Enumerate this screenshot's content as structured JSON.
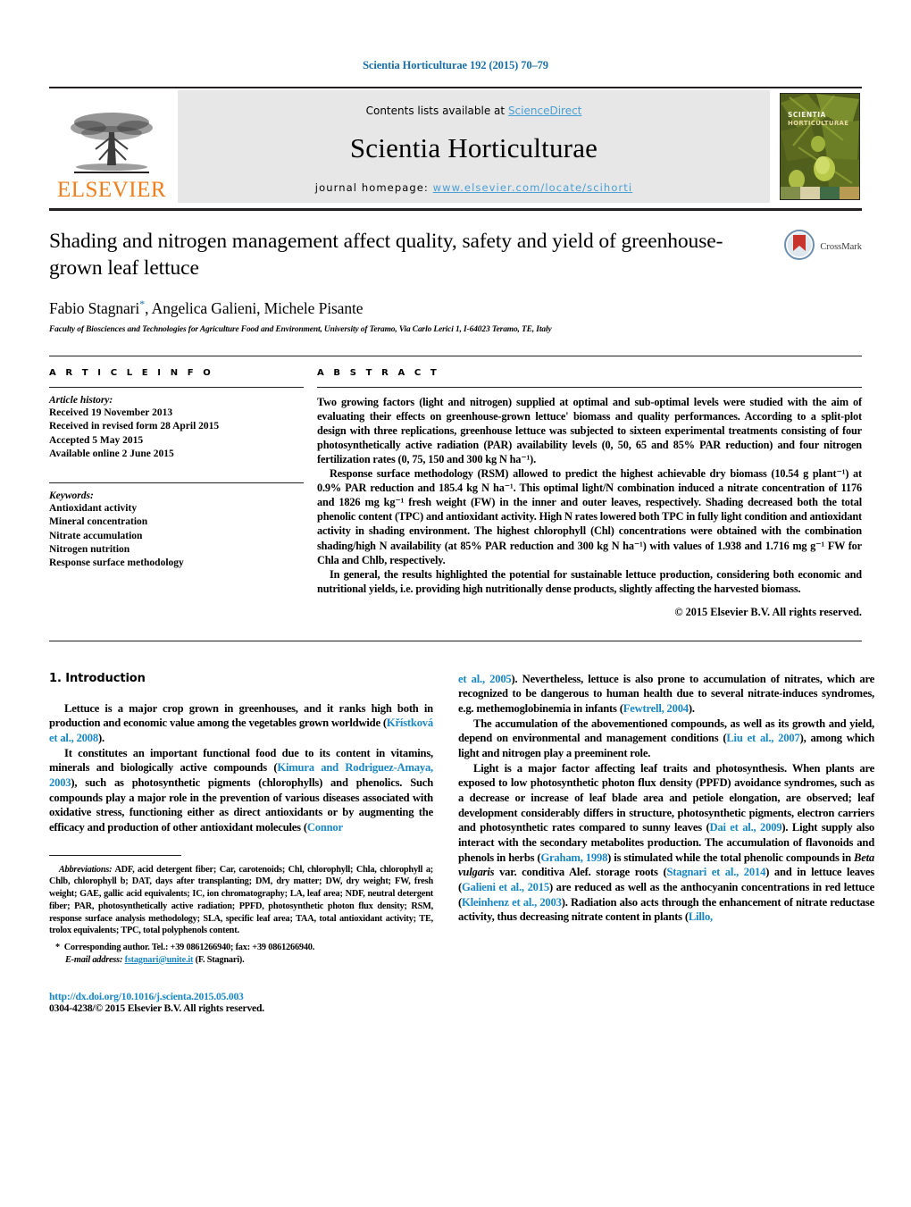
{
  "running_head": "Scientia Horticulturae 192 (2015) 70–79",
  "masthead": {
    "publisher_wordmark": "ELSEVIER",
    "contents_prefix": "Contents lists available at ",
    "contents_link": "ScienceDirect",
    "journal_title": "Scientia Horticulturae",
    "homepage_prefix": "journal homepage: ",
    "homepage_url": "www.elsevier.com/locate/scihorti",
    "cover_title_line1": "SCIENTIA",
    "cover_title_line2": "HORTICULTURAE",
    "accent_orange": "#ef7d1a",
    "link_blue": "#4a9fd4"
  },
  "article": {
    "title": "Shading and nitrogen management affect quality, safety and yield of greenhouse-grown leaf lettuce",
    "authors": "Fabio Stagnari, Angelica Galieni, Michele Pisante",
    "author_star": "*",
    "affiliation": "Faculty of Biosciences and Technologies for Agriculture Food and Environment, University of Teramo, Via Carlo Lerici 1, I-64023 Teramo, TE, Italy",
    "crossmark_label": "CrossMark"
  },
  "article_info": {
    "heading": "A R T I C L E   I N F O",
    "history_label": "Article history:",
    "history": [
      "Received 19 November 2013",
      "Received in revised form 28 April 2015",
      "Accepted 5 May 2015",
      "Available online 2 June 2015"
    ],
    "keywords_label": "Keywords:",
    "keywords": [
      "Antioxidant activity",
      "Mineral concentration",
      "Nitrate accumulation",
      "Nitrogen nutrition",
      "Response surface methodology"
    ]
  },
  "abstract": {
    "heading": "A B S T R A C T",
    "paragraph_1": "Two growing factors (light and nitrogen) supplied at optimal and sub-optimal levels were studied with the aim of evaluating their effects on greenhouse-grown lettuce' biomass and quality performances. According to a split-plot design with three replications, greenhouse lettuce was subjected to sixteen experimental treatments consisting of four photosynthetically active radiation (PAR) availability levels (0, 50, 65 and 85% PAR reduction) and four nitrogen fertilization rates (0, 75, 150 and 300 kg N ha⁻¹).",
    "paragraph_2": "Response surface methodology (RSM) allowed to predict the highest achievable dry biomass (10.54 g plant⁻¹) at 0.9% PAR reduction and 185.4 kg N ha⁻¹. This optimal light/N combination induced a nitrate concentration of 1176 and 1826 mg kg⁻¹ fresh weight (FW) in the inner and outer leaves, respectively. Shading decreased both the total phenolic content (TPC) and antioxidant activity. High N rates lowered both TPC in fully light condition and antioxidant activity in shading environment. The highest chlorophyll (Chl) concentrations were obtained with the combination shading/high N availability (at 85% PAR reduction and 300 kg N ha⁻¹) with values of 1.938 and 1.716 mg g⁻¹ FW for Chla and Chlb, respectively.",
    "paragraph_3": "In general, the results highlighted the potential for sustainable lettuce production, considering both economic and nutritional yields, i.e. providing high nutritionally dense products, slightly affecting the harvested biomass.",
    "copyright": "© 2015 Elsevier B.V. All rights reserved."
  },
  "introduction": {
    "heading": "1.  Introduction",
    "left_paragraph_1": "Lettuce is a major crop grown in greenhouses, and it ranks high both in production and economic value among the vegetables grown worldwide (Křístková et al., 2008).",
    "left_paragraph_2": "It constitutes an important functional food due to its content in vitamins, minerals and biologically active compounds (Kimura and Rodriguez-Amaya, 2003), such as photosynthetic pigments (chlorophylls) and phenolics. Such compounds play a major role in the prevention of various diseases associated with oxidative stress, functioning either as direct antioxidants or by augmenting the efficacy and production of other antioxidant molecules (Connor",
    "right_paragraph_1": "et al., 2005). Nevertheless, lettuce is also prone to accumulation of nitrates, which are recognized to be dangerous to human health due to several nitrate-induces syndromes, e.g. methemoglobinemia in infants (Fewtrell, 2004).",
    "right_paragraph_2": "The accumulation of the abovementioned compounds, as well as its growth and yield, depend on environmental and management conditions (Liu et al., 2007), among which light and nitrogen play a preeminent role.",
    "right_paragraph_3": "Light is a major factor affecting leaf traits and photosynthesis. When plants are exposed to low photosynthetic photon flux density (PPFD) avoidance syndromes, such as a decrease or increase of leaf blade area and petiole elongation, are observed; leaf development considerably differs in structure, photosynthetic pigments, electron carriers and photosynthetic rates compared to sunny leaves (Dai et al., 2009). Light supply also interact with the secondary metabolites production. The accumulation of flavonoids and phenols in herbs (Graham, 1998) is stimulated while the total phenolic compounds in Beta vulgaris var. conditiva Alef. storage roots (Stagnari et al., 2014) and in lettuce leaves (Galieni et al., 2015) are reduced as well as the anthocyanin concentrations in red lettuce (Kleinhenz et al., 2003). Radiation also acts through the enhancement of nitrate reductase activity, thus decreasing nitrate content in plants (Lillo,"
  },
  "footnotes": {
    "abbreviations_label": "Abbreviations:",
    "abbreviations_text": " ADF, acid detergent fiber; Car, carotenoids; Chl, chlorophyll; Chla, chlorophyll a; Chlb, chlorophyll b; DAT, days after transplanting; DM, dry matter; DW, dry weight; FW, fresh weight; GAE, gallic acid equivalents; IC, ion chromatography; LA, leaf area; NDF, neutral detergent fiber; PAR, photosynthetically active radiation; PPFD, photosynthetic photon flux density; RSM, response surface analysis methodology; SLA, specific leaf area; TAA, total antioxidant activity; TE, trolox equivalents; TPC, total polyphenols content.",
    "corresponding": "Corresponding author. Tel.: +39 0861266940; fax: +39 0861266940.",
    "email_label": "E-mail address:",
    "email": "fstagnari@unite.it",
    "email_suffix": " (F. Stagnari).",
    "doi": "http://dx.doi.org/10.1016/j.scienta.2015.05.003",
    "issn": "0304-4238/© 2015 Elsevier B.V. All rights reserved."
  }
}
